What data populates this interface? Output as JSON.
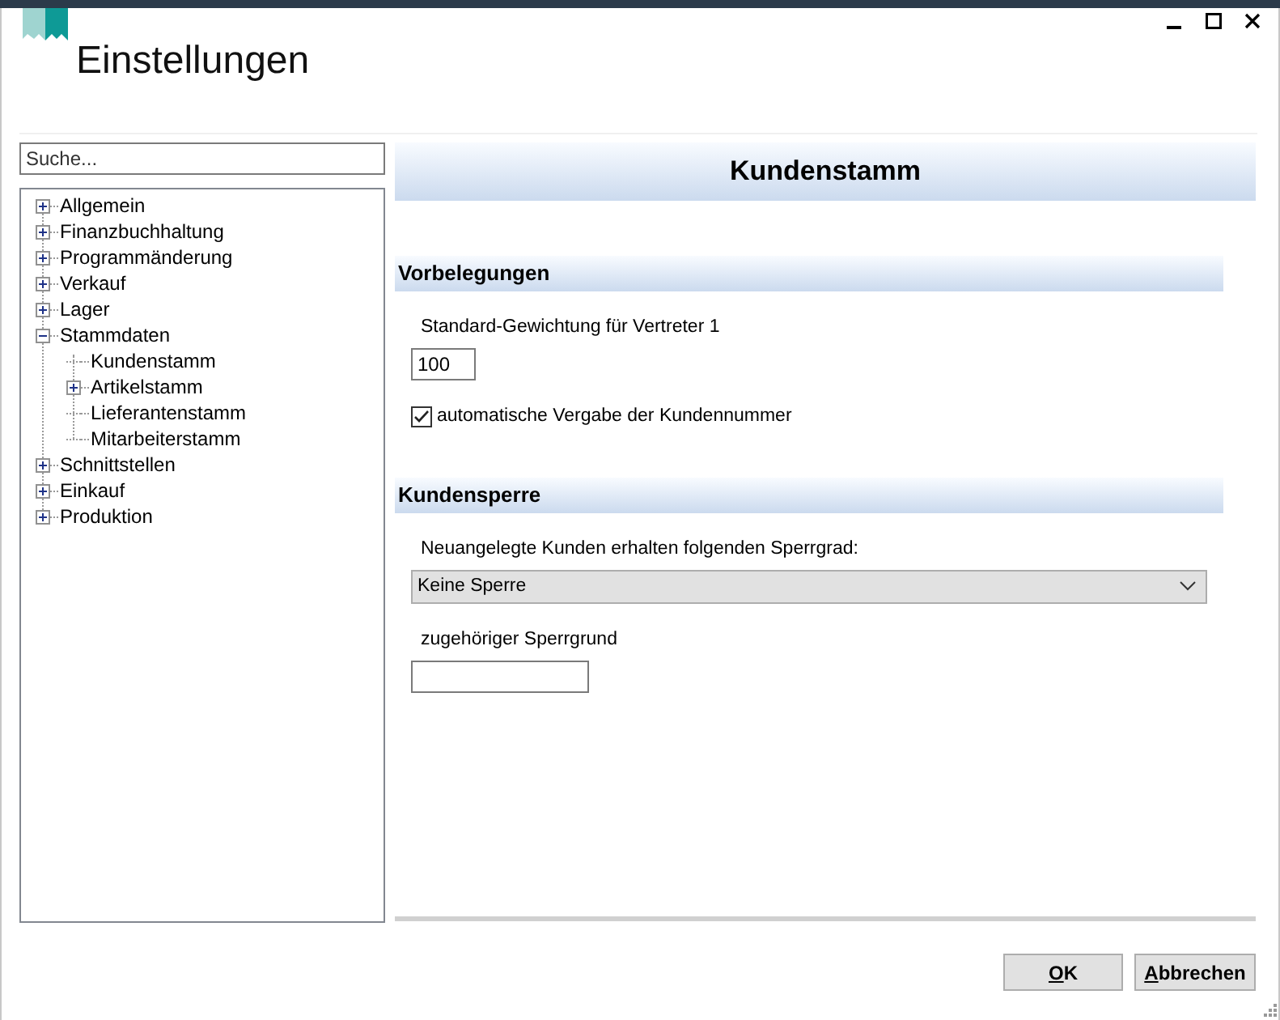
{
  "window": {
    "title": "Einstellungen"
  },
  "search": {
    "placeholder": "Suche..."
  },
  "tree": [
    {
      "label": "Allgemein",
      "expanded": false
    },
    {
      "label": "Finanzbuchhaltung",
      "expanded": false
    },
    {
      "label": "Programmänderung",
      "expanded": false
    },
    {
      "label": "Verkauf",
      "expanded": false
    },
    {
      "label": "Lager",
      "expanded": false
    },
    {
      "label": "Stammdaten",
      "expanded": true,
      "children": [
        {
          "label": "Kundenstamm"
        },
        {
          "label": "Artikelstamm",
          "expanded": false
        },
        {
          "label": "Lieferantenstamm"
        },
        {
          "label": "Mitarbeiterstamm"
        }
      ]
    },
    {
      "label": "Schnittstellen",
      "expanded": false
    },
    {
      "label": "Einkauf",
      "expanded": false
    },
    {
      "label": "Produktion",
      "expanded": false
    }
  ],
  "panel": {
    "title": "Kundenstamm",
    "sections": [
      {
        "title": "Vorbelegungen",
        "fields": [
          {
            "kind": "text",
            "label": "Standard-Gewichtung für Vertreter 1",
            "value": "100"
          },
          {
            "kind": "checkbox",
            "label": "automatische Vergabe der Kundennummer",
            "checked": true
          }
        ]
      },
      {
        "title": "Kundensperre",
        "fields": [
          {
            "kind": "select",
            "label": "Neuangelegte Kunden erhalten folgenden Sperrgrad:",
            "value": "Keine Sperre"
          },
          {
            "kind": "text",
            "label": "zugehöriger Sperrgrund"
          }
        ]
      }
    ]
  },
  "buttons": [
    "OK",
    "Abbrechen"
  ]
}
